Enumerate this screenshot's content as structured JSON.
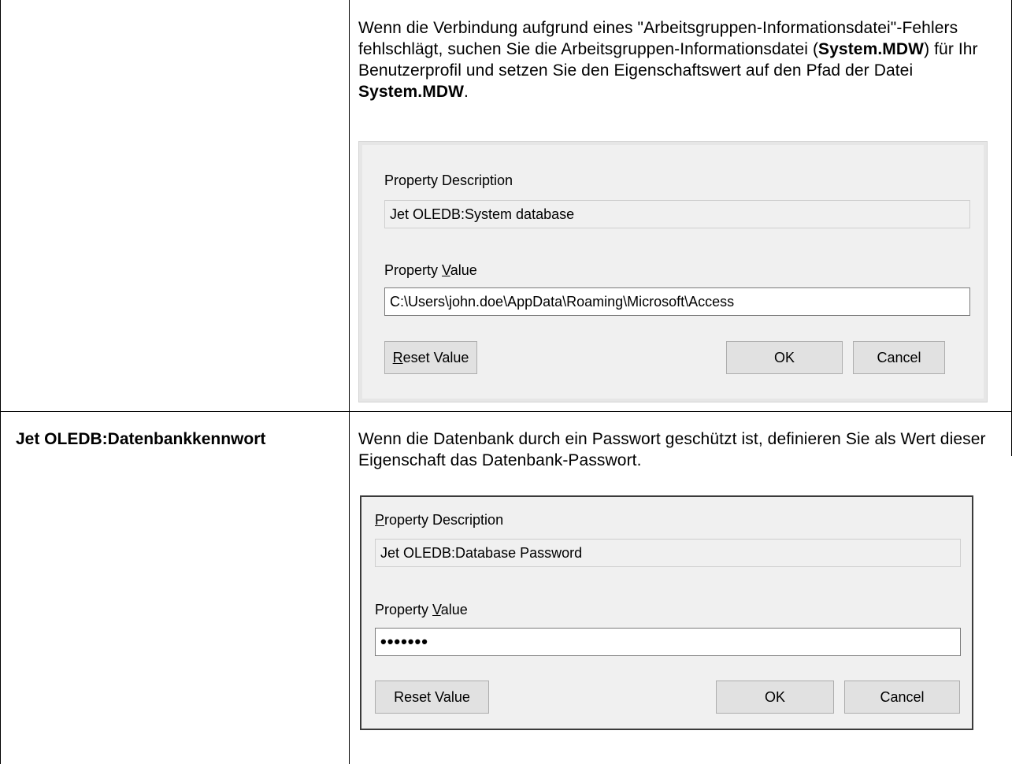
{
  "rows": [
    {
      "term": "",
      "description_parts": [
        {
          "text": "Wenn die Verbindung aufgrund eines \"Arbeitsgruppen-Informationsdatei\"-Fehlers fehlschlägt, suchen Sie die Arbeitsgruppen-Informationsdatei (",
          "bold": false
        },
        {
          "text": "System.MDW",
          "bold": true
        },
        {
          "text": ") für Ihr Benutzerprofil und setzen Sie den Eigenschaftswert auf den Pfad der Datei ",
          "bold": false
        },
        {
          "text": "System.MDW",
          "bold": true
        },
        {
          "text": ".",
          "bold": false
        }
      ],
      "dialog": {
        "description_label": "Property Description",
        "description_value": "Jet OLEDB:System database",
        "value_label_prefix": "Property ",
        "value_label_accel": "V",
        "value_label_suffix": "alue",
        "value": "C:\\Users\\john.doe\\AppData\\Roaming\\Microsoft\\Access",
        "reset_accel": "R",
        "reset_rest": "eset Value",
        "ok_label": "OK",
        "cancel_label": "Cancel"
      }
    },
    {
      "term": "Jet OLEDB:Datenbankkennwort",
      "description_parts": [
        {
          "text": "Wenn die Datenbank durch ein Passwort geschützt ist, definieren Sie als Wert dieser Eigenschaft das Datenbank-Passwort.",
          "bold": false
        }
      ],
      "dialog": {
        "description_label_accel": "P",
        "description_label_rest": "roperty Description",
        "description_value": "Jet OLEDB:Database Password",
        "value_label_prefix": "Property ",
        "value_label_accel": "V",
        "value_label_suffix": "alue",
        "value": "•••••••",
        "reset_label": "Reset Value",
        "ok_label": "OK",
        "cancel_label": "Cancel"
      }
    }
  ]
}
